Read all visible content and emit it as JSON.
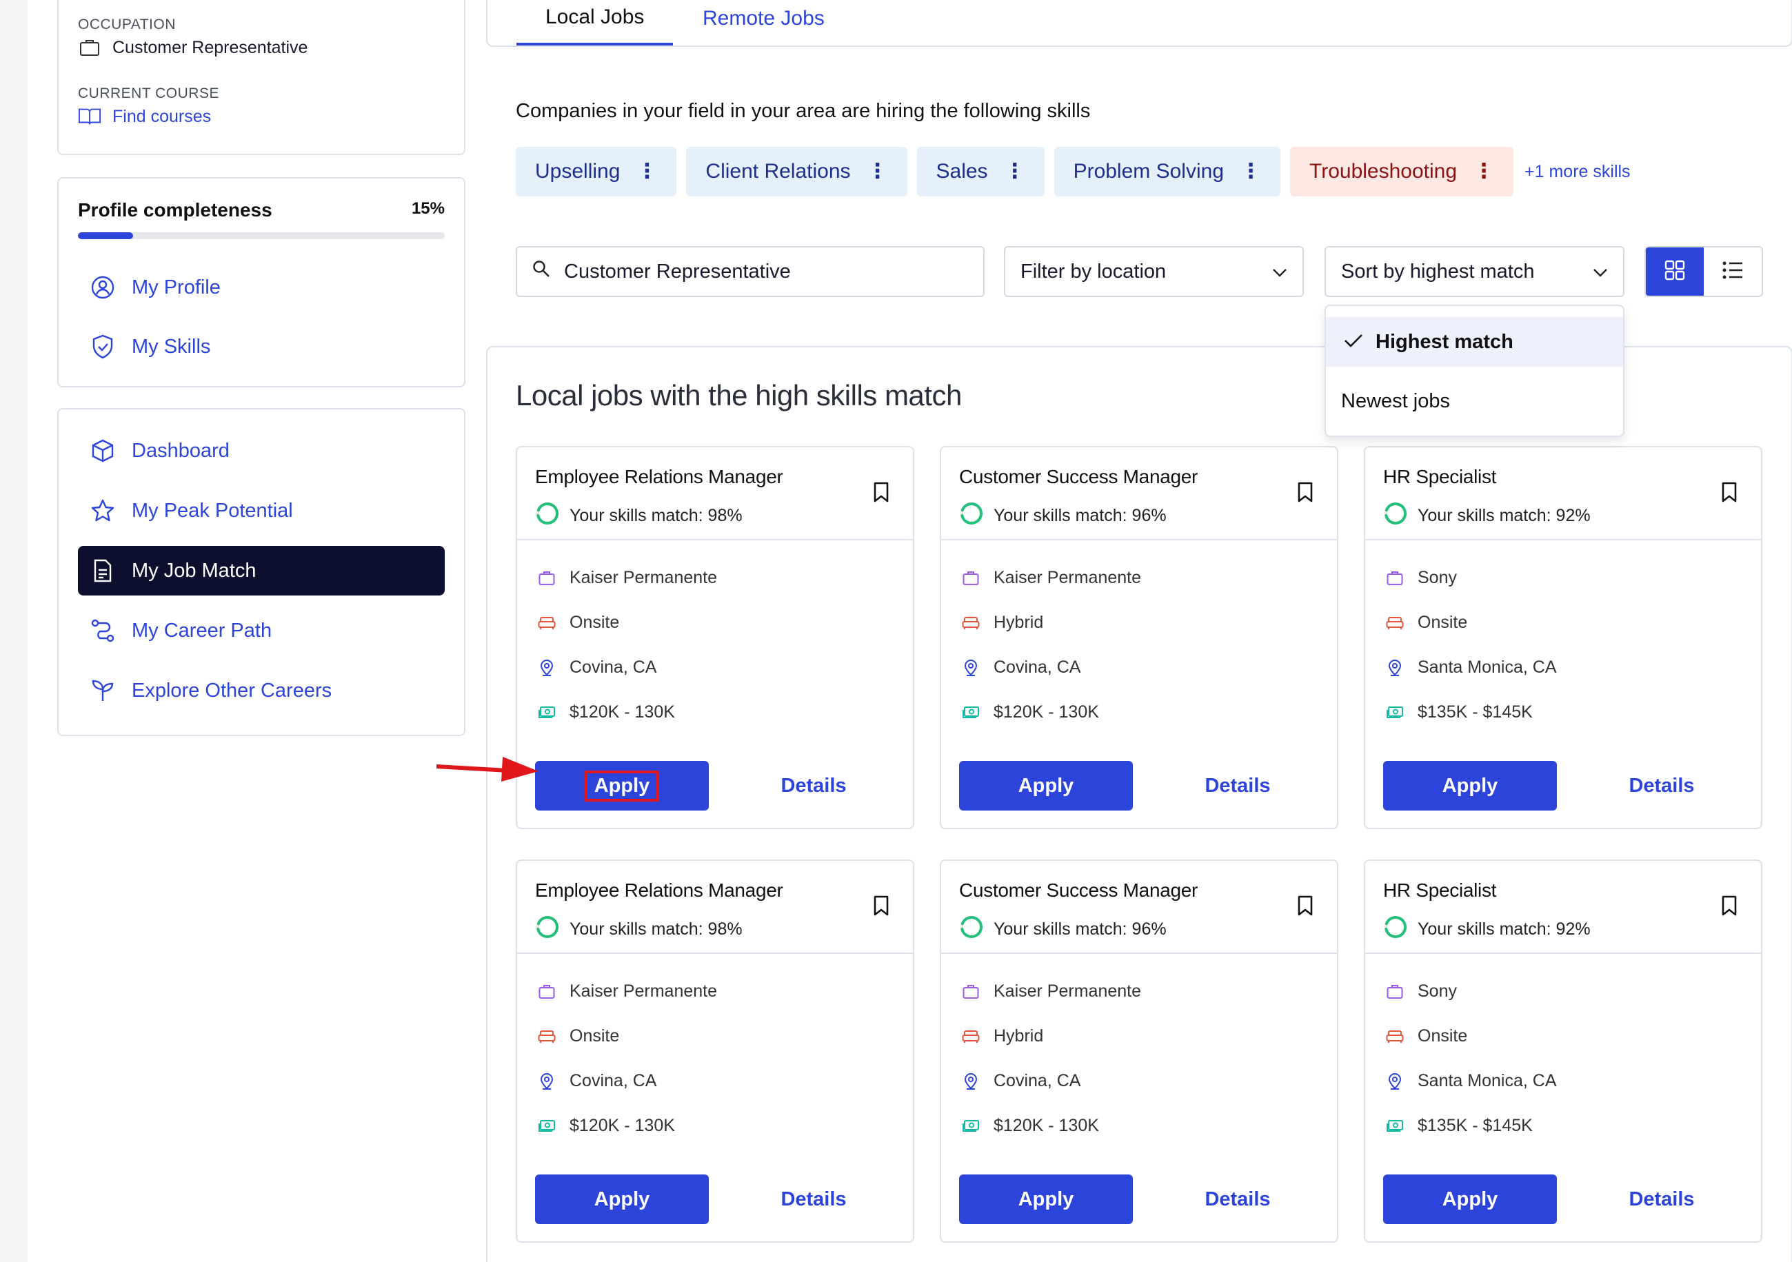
{
  "occupation": {
    "label": "OCCUPATION",
    "value": "Customer Representative",
    "course_label": "CURRENT COURSE",
    "course_link": "Find courses"
  },
  "profile": {
    "title": "Profile completeness",
    "percent_label": "15%",
    "progress_fraction": 0.15,
    "links": [
      "My Profile",
      "My Skills"
    ]
  },
  "nav": {
    "items": [
      {
        "label": "Dashboard",
        "icon": "cube-icon",
        "active": false
      },
      {
        "label": "My Peak Potential",
        "icon": "star-icon",
        "active": false
      },
      {
        "label": "My Job Match",
        "icon": "document-icon",
        "active": true
      },
      {
        "label": "My Career Path",
        "icon": "path-icon",
        "active": false
      },
      {
        "label": "Explore Other Careers",
        "icon": "sprout-icon",
        "active": false
      }
    ]
  },
  "tabs": [
    {
      "label": "Local Jobs",
      "active": true
    },
    {
      "label": "Remote Jobs",
      "active": false
    }
  ],
  "hiring_text": "Companies in your field in your area are hiring the following skills",
  "skills": [
    {
      "label": "Upselling",
      "warn": false
    },
    {
      "label": "Client Relations",
      "warn": false
    },
    {
      "label": "Sales",
      "warn": false
    },
    {
      "label": "Problem Solving",
      "warn": false
    },
    {
      "label": "Troubleshooting",
      "warn": true
    }
  ],
  "more_skills": "+1 more skills",
  "search": {
    "value": "Customer Representative"
  },
  "filters": {
    "location": "Filter by location",
    "sort": "Sort by highest match"
  },
  "sort_menu": {
    "options": [
      "Highest match",
      "Newest jobs"
    ],
    "selected": "Highest match"
  },
  "jobs_title": "Local jobs with the high skills match",
  "jobs": [
    {
      "title": "Employee Relations Manager",
      "match": "Your skills match: 98%",
      "company": "Kaiser Permanente",
      "work_type": "Onsite",
      "location": "Covina, CA",
      "salary": "$120K - 130K",
      "apply": "Apply",
      "details": "Details"
    },
    {
      "title": "Customer Success Manager",
      "match": "Your skills match: 96%",
      "company": "Kaiser Permanente",
      "work_type": "Hybrid",
      "location": "Covina, CA",
      "salary": "$120K - 130K",
      "apply": "Apply",
      "details": "Details"
    },
    {
      "title": "HR Specialist",
      "match": "Your skills match: 92%",
      "company": "Sony",
      "work_type": "Onsite",
      "location": "Santa Monica, CA",
      "salary": "$135K - $145K",
      "apply": "Apply",
      "details": "Details"
    },
    {
      "title": "Employee Relations Manager",
      "match": "Your skills match: 98%",
      "company": "Kaiser Permanente",
      "work_type": "Onsite",
      "location": "Covina, CA",
      "salary": "$120K - 130K",
      "apply": "Apply",
      "details": "Details"
    },
    {
      "title": "Customer Success Manager",
      "match": "Your skills match: 96%",
      "company": "Kaiser Permanente",
      "work_type": "Hybrid",
      "location": "Covina, CA",
      "salary": "$120K - 130K",
      "apply": "Apply",
      "details": "Details"
    },
    {
      "title": "HR Specialist",
      "match": "Your skills match: 92%",
      "company": "Sony",
      "work_type": "Onsite",
      "location": "Santa Monica, CA",
      "salary": "$135K - $145K",
      "apply": "Apply",
      "details": "Details"
    }
  ],
  "colors": {
    "accent": "#2c44d9",
    "active_nav_bg": "#0c0f2e",
    "match_ring": "#22c07a",
    "warn_chip_bg": "#fde8e3",
    "annotation_red": "#e0161b"
  }
}
